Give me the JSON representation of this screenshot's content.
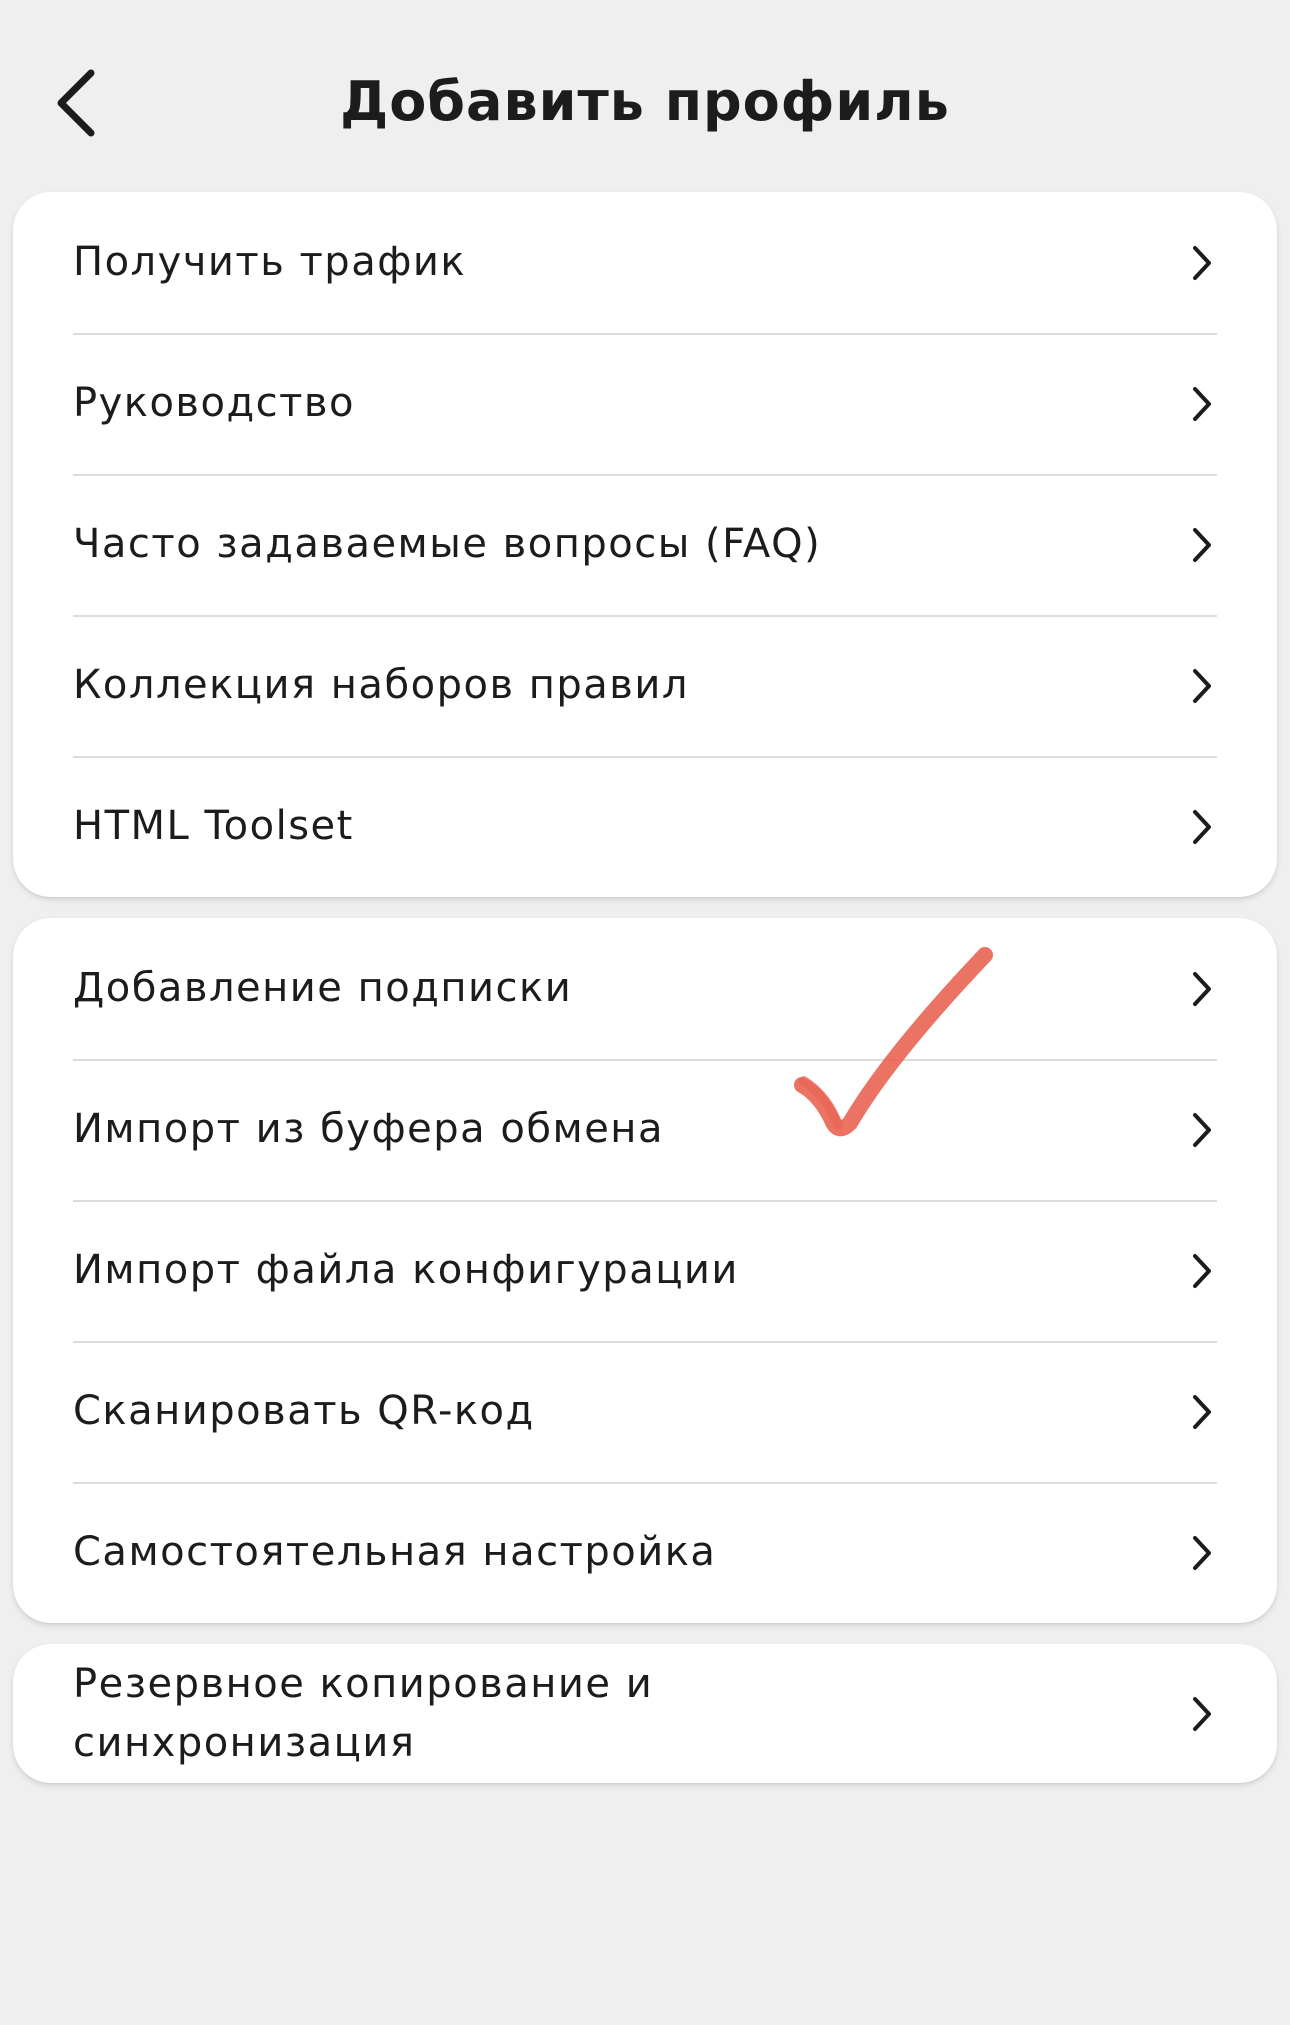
{
  "header": {
    "title": "Добавить профиль",
    "back_icon": "chevron-left-icon"
  },
  "groups": [
    {
      "items": [
        {
          "label": "Получить трафик",
          "icon": "chevron-right-icon"
        },
        {
          "label": "Руководство",
          "icon": "chevron-right-icon"
        },
        {
          "label": "Часто задаваемые вопросы (FAQ)",
          "icon": "chevron-right-icon"
        },
        {
          "label": "Коллекция наборов правил",
          "icon": "chevron-right-icon"
        },
        {
          "label": "HTML Toolset",
          "icon": "chevron-right-icon"
        }
      ]
    },
    {
      "items": [
        {
          "label": "Добавление подписки",
          "icon": "chevron-right-icon"
        },
        {
          "label": "Импорт из буфера обмена",
          "icon": "chevron-right-icon"
        },
        {
          "label": "Импорт файла конфигурации",
          "icon": "chevron-right-icon"
        },
        {
          "label": "Сканировать QR-код",
          "icon": "chevron-right-icon"
        },
        {
          "label": "Самостоятельная настройка",
          "icon": "chevron-right-icon"
        }
      ]
    },
    {
      "items": [
        {
          "label": "Резервное копирование и синхронизация",
          "icon": "chevron-right-icon"
        }
      ]
    }
  ],
  "annotation": {
    "icon": "checkmark-annotation-icon",
    "color": "#e8604f"
  },
  "colors": {
    "background": "#efefef",
    "card": "#ffffff",
    "separator": "#dcdcdc",
    "text": "#1c1c1c"
  }
}
